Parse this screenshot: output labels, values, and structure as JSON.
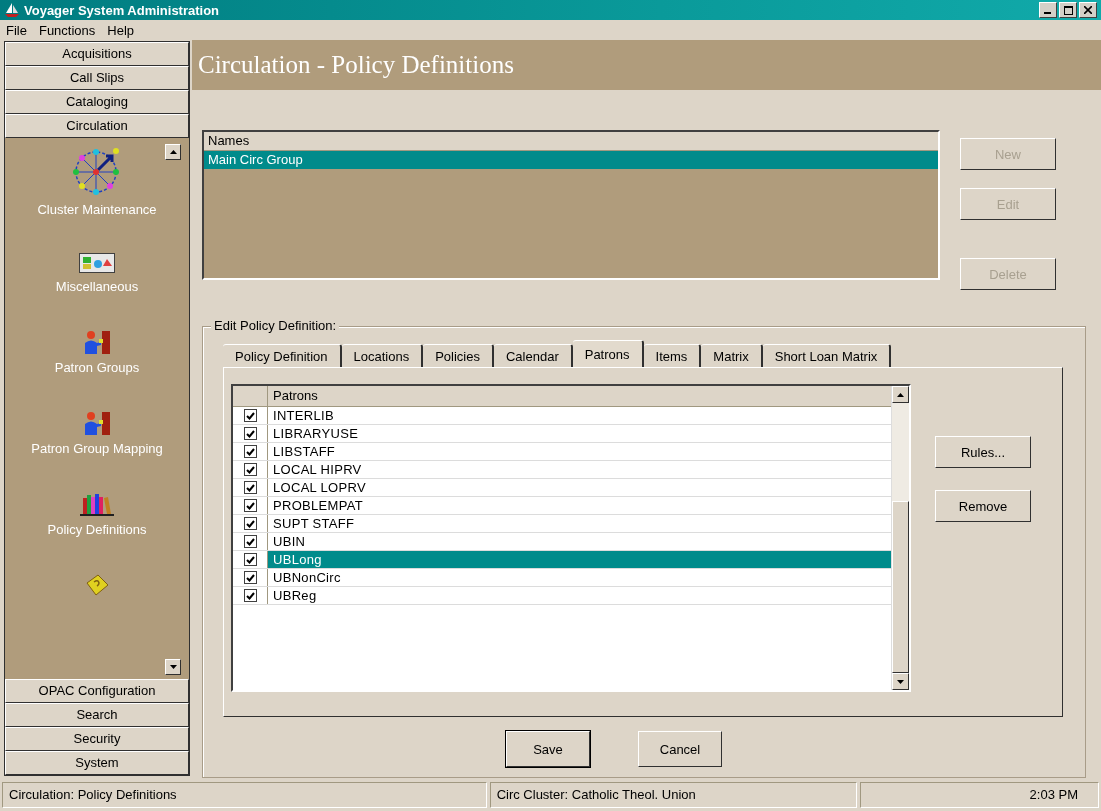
{
  "window": {
    "title": "Voyager System Administration"
  },
  "menu": [
    "File",
    "Functions",
    "Help"
  ],
  "sidebar": {
    "top_modules": [
      "Acquisitions",
      "Call Slips",
      "Cataloging",
      "Circulation"
    ],
    "items": [
      {
        "kind": "cluster",
        "label": "Cluster Maintenance"
      },
      {
        "kind": "misc",
        "label": "Miscellaneous"
      },
      {
        "kind": "patron",
        "label": "Patron Groups"
      },
      {
        "kind": "patron",
        "label": "Patron Group Mapping"
      },
      {
        "kind": "books",
        "label": "Policy Definitions"
      },
      {
        "kind": "request"
      }
    ],
    "bottom_modules": [
      "OPAC Configuration",
      "Search",
      "Security",
      "System"
    ]
  },
  "header": {
    "title": "Circulation - Policy Definitions"
  },
  "names": {
    "column": "Names",
    "rows": [
      {
        "name": "Main Circ Group",
        "selected": true
      }
    ]
  },
  "name_buttons": [
    {
      "label": "New",
      "disabled": true
    },
    {
      "label": "Edit",
      "disabled": true
    },
    {
      "label": "Delete",
      "disabled": true
    }
  ],
  "edit_group": {
    "title": "Edit  Policy Definition:",
    "tabs": [
      {
        "label": "Policy Definition",
        "selected": false
      },
      {
        "label": "Locations",
        "selected": false
      },
      {
        "label": "Policies",
        "selected": false
      },
      {
        "label": "Calendar",
        "selected": false
      },
      {
        "label": "Patrons",
        "selected": true
      },
      {
        "label": "Items",
        "selected": false
      },
      {
        "label": "Matrix",
        "selected": false
      },
      {
        "label": "Short Loan Matrix",
        "selected": false
      }
    ],
    "patrons": {
      "column": "Patrons",
      "rows": [
        {
          "name": "INTERLIB",
          "checked": true,
          "selected": false
        },
        {
          "name": "LIBRARYUSE",
          "checked": true,
          "selected": false
        },
        {
          "name": "LIBSTAFF",
          "checked": true,
          "selected": false
        },
        {
          "name": "LOCAL HIPRV",
          "checked": true,
          "selected": false
        },
        {
          "name": "LOCAL LOPRV",
          "checked": true,
          "selected": false
        },
        {
          "name": "PROBLEMPAT",
          "checked": true,
          "selected": false
        },
        {
          "name": "SUPT STAFF",
          "checked": true,
          "selected": false
        },
        {
          "name": "UBIN",
          "checked": true,
          "selected": false
        },
        {
          "name": "UBLong",
          "checked": true,
          "selected": true
        },
        {
          "name": "UBNonCirc",
          "checked": true,
          "selected": false
        },
        {
          "name": "UBReg",
          "checked": true,
          "selected": false
        }
      ]
    },
    "side_buttons": [
      "Rules...",
      "Remove"
    ]
  },
  "footer_buttons": [
    "Save",
    "Cancel"
  ],
  "status_bar": [
    "Circulation:  Policy Definitions",
    "Circ Cluster:  Catholic Theol. Union",
    "2:03 PM"
  ]
}
